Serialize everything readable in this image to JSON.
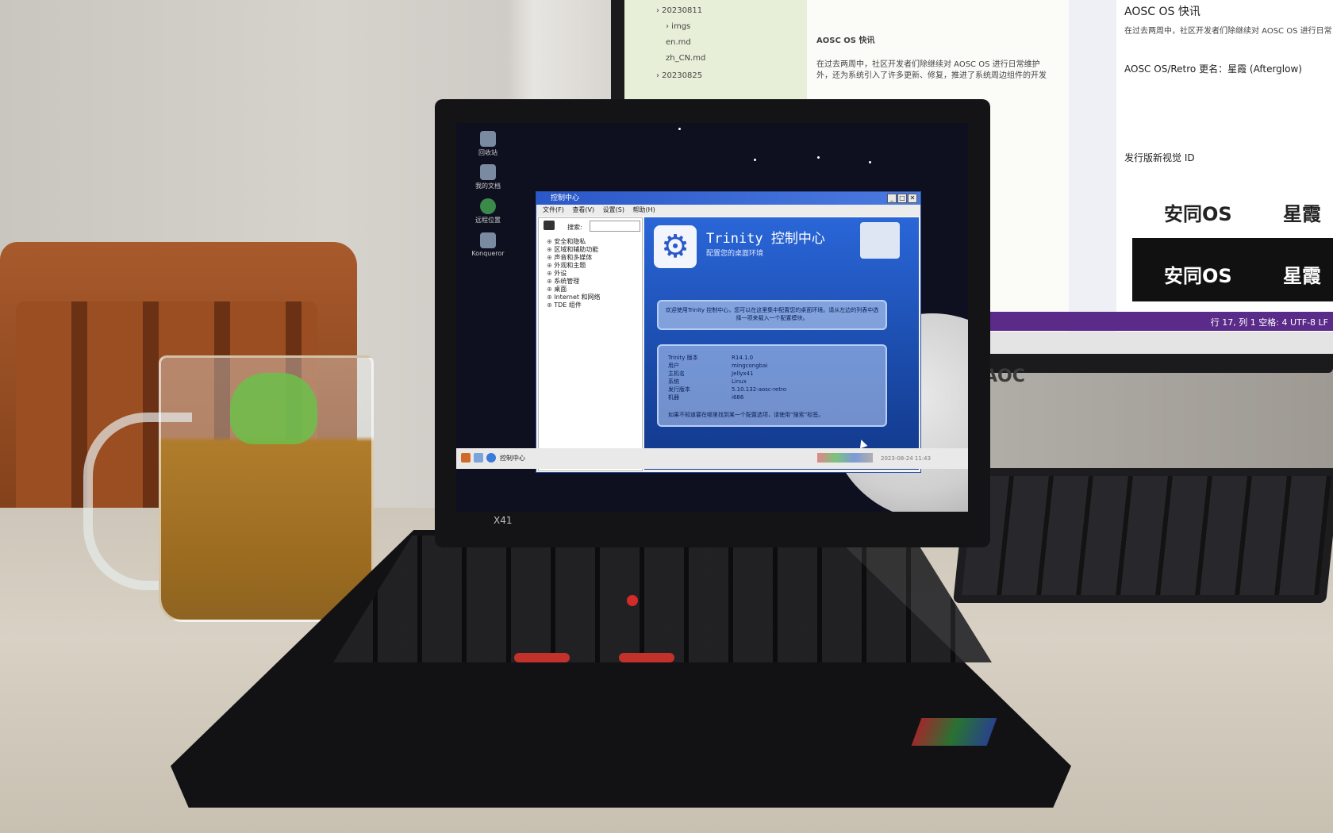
{
  "monitor": {
    "editor_heading": "AOSC OS 快讯",
    "editor_text": "在过去两周中，社区开发者们除继续对 AOSC OS 进行日常维护外，还为系统引入了许多更新、修复，推进了系统周边组件的开发",
    "preview_title": "AOSC OS 快讯",
    "preview_line1": "在过去两周中，社区开发者们除继续对 AOSC OS 进行日常",
    "preview_line2": "AOSC OS/Retro 更名：星霞 (Afterglow)",
    "preview_line3": "发行版新视觉 ID",
    "brand_left": "安同OS",
    "brand_right": "星霞",
    "statusbar": "行 17, 列 1   空格: 4   UTF-8   LF",
    "brand": "AOC"
  },
  "laptop": {
    "model": "X41"
  },
  "desktop_icons": [
    {
      "label": "回收站",
      "icon": "trash-icon"
    },
    {
      "label": "我的文档",
      "icon": "documents-icon"
    },
    {
      "label": "远程位置",
      "icon": "globe-icon"
    },
    {
      "label": "Konqueror",
      "icon": "browser-icon"
    }
  ],
  "control_center": {
    "title": "控制中心",
    "menu": [
      "文件(F)",
      "查看(V)",
      "设置(S)",
      "帮助(H)"
    ],
    "search_label": "搜索:",
    "search_value": "",
    "tree": [
      "安全和隐私",
      "区域和辅助功能",
      "声音和多媒体",
      "外观和主题",
      "外设",
      "系统管理",
      "桌面",
      "Internet 和网络",
      "TDE 组件"
    ],
    "heading": "Trinity 控制中心",
    "subheading": "配置您的桌面环境",
    "welcome": "欢迎使用Trinity 控制中心，您可以在这里集中配置您的桌面环境。请从左边的列表中选择一项来载入一个配置模块。",
    "details": [
      {
        "key": "Trinity 版本",
        "value": "R14.1.0"
      },
      {
        "key": "用户",
        "value": "mingcongbai"
      },
      {
        "key": "主机名",
        "value": "Jellyx41"
      },
      {
        "key": "系统",
        "value": "Linux"
      },
      {
        "key": "发行版本",
        "value": "5.10.132-aosc-retro"
      },
      {
        "key": "机器",
        "value": "i686"
      }
    ],
    "footer_hint": "如果不知道要在哪里找到某一个配置选项，请使用“搜索”标签。"
  },
  "taskbar": {
    "task_label": "控制中心",
    "clock": "2023-08-24 11:43"
  }
}
